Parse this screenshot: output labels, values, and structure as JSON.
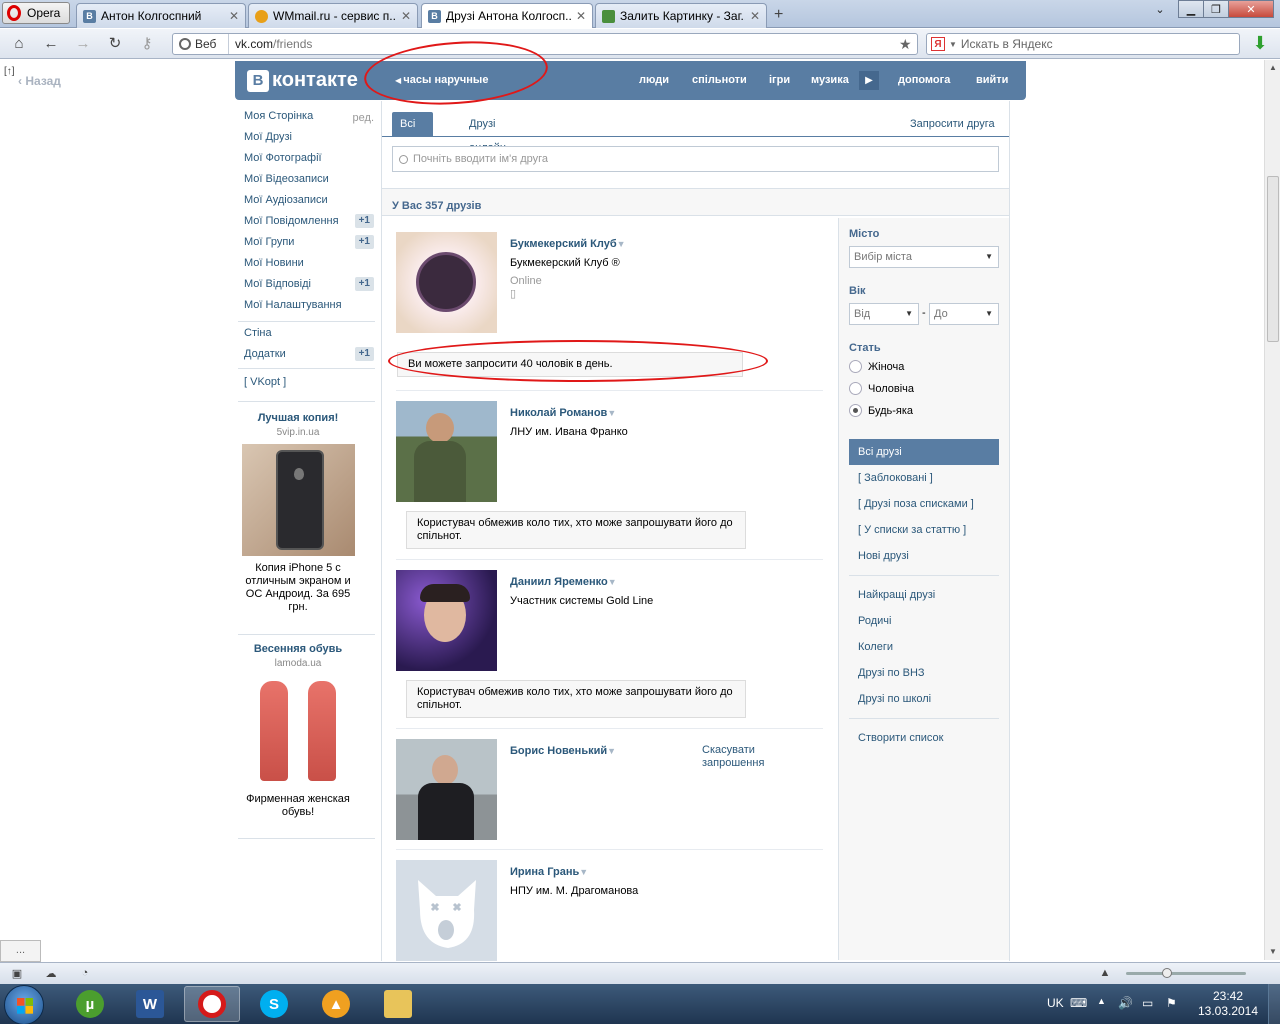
{
  "browser": {
    "menu_label": "Opera",
    "tabs": [
      {
        "label": "Антон Колгоспний",
        "icon": "vk-icon",
        "color": "#597da3"
      },
      {
        "label": "WMmail.ru - сервис п...",
        "icon": "wmmail-icon",
        "color": "#e8a019"
      },
      {
        "label": "Друзі Антона Колгосп...",
        "icon": "vk-icon",
        "color": "#597da3"
      },
      {
        "label": "Залить Картинку - Заг...",
        "icon": "image-host-icon",
        "color": "#4a8f3c"
      }
    ],
    "address_prefix": "Веб",
    "address_host": "vk.com",
    "address_path": "/friends",
    "search_placeholder": "Искать в Яндекс",
    "panel_toggle": "[↑]",
    "back_label": "Назад",
    "status_dots": "...",
    "yandex_letter": "Я"
  },
  "vk": {
    "logo_text": "контакте",
    "logo_letter": "В",
    "status": "часы наручные",
    "nav": [
      "люди",
      "спільноти",
      "ігри",
      "музика",
      "допомога",
      "вийти"
    ],
    "left_menu": [
      {
        "label": "Моя Сторінка",
        "extra": "ред."
      },
      {
        "label": "Мої Друзі",
        "extra": ""
      },
      {
        "label": "Мої Фотографії",
        "extra": ""
      },
      {
        "label": "Мої Відеозаписи",
        "extra": ""
      },
      {
        "label": "Мої Аудіозаписи",
        "extra": ""
      },
      {
        "label": "Мої Повідомлення",
        "extra": "+1"
      },
      {
        "label": "Мої Групи",
        "extra": "+1"
      },
      {
        "label": "Мої Новини",
        "extra": ""
      },
      {
        "label": "Мої Відповіді",
        "extra": "+1"
      },
      {
        "label": "Мої Налаштування",
        "extra": ""
      },
      {
        "label": "Стіна",
        "extra": ""
      },
      {
        "label": "Додатки",
        "extra": "+1"
      },
      {
        "label": "[ VKopt ]",
        "extra": ""
      }
    ],
    "ads": [
      {
        "title": "Лучшая копия!",
        "domain": "5vip.in.ua",
        "caption": "Копия iPhone 5 с отличным экраном и ОС Андроид. За 695 грн."
      },
      {
        "title": "Весенняя обувь",
        "domain": "lamoda.ua",
        "caption": "Фирменная женская обувь!"
      }
    ],
    "tabs": {
      "all": "Всі друзі",
      "online": "Друзі онлайн",
      "invite": "Запросити друга"
    },
    "search_placeholder": "Почніть вводити ім'я друга",
    "friends_count": "У Вас 357 друзів",
    "friends": [
      {
        "name": "Букмекерский Клуб",
        "sub": "Букмекерский Клуб ®",
        "online": "Online",
        "notice": "Ви можете запросити 40 чоловік в день."
      },
      {
        "name": "Николай Романов",
        "sub": "ЛНУ им. Ивана Франко",
        "online": "",
        "notice": "Користувач обмежив коло тих, хто може запрошувати його до спільнот."
      },
      {
        "name": "Даниил Яременко",
        "sub": "Участник системы Gold Line",
        "online": "",
        "notice": "Користувач обмежив коло тих, хто може запрошувати його до спільнот."
      },
      {
        "name": "Борис Новенький",
        "sub": "",
        "online": "",
        "notice": ""
      },
      {
        "name": "Ирина Грань",
        "sub": "НПУ им. М. Драгоманова",
        "online": "",
        "notice": ""
      }
    ],
    "cancel_request": "Скасувати запрошення",
    "filters": {
      "city_label": "Місто",
      "city_value": "Вибір міста",
      "age_label": "Вік",
      "age_from": "Від",
      "age_dash": "-",
      "age_to": "До",
      "sex_label": "Стать",
      "sex_options": [
        "Жіноча",
        "Чоловіча",
        "Будь-яка"
      ],
      "sex_selected": "Будь-яка",
      "lists": [
        "Всі друзі",
        "[ Заблоковані ]",
        "[ Друзі поза списками ]",
        "[ У списки за статтю ]",
        "Нові друзі"
      ],
      "groups": [
        "Найкращі друзі",
        "Родичі",
        "Колеги",
        "Друзі по ВНЗ",
        "Друзі по школі"
      ],
      "create_list": "Створити список"
    }
  },
  "taskbar": {
    "language": "UK",
    "time": "23:42",
    "date": "13.03.2014"
  },
  "colors": {
    "vk_blue": "#597da3",
    "vk_link": "#2b587a",
    "annotation_red": "#e01818"
  }
}
